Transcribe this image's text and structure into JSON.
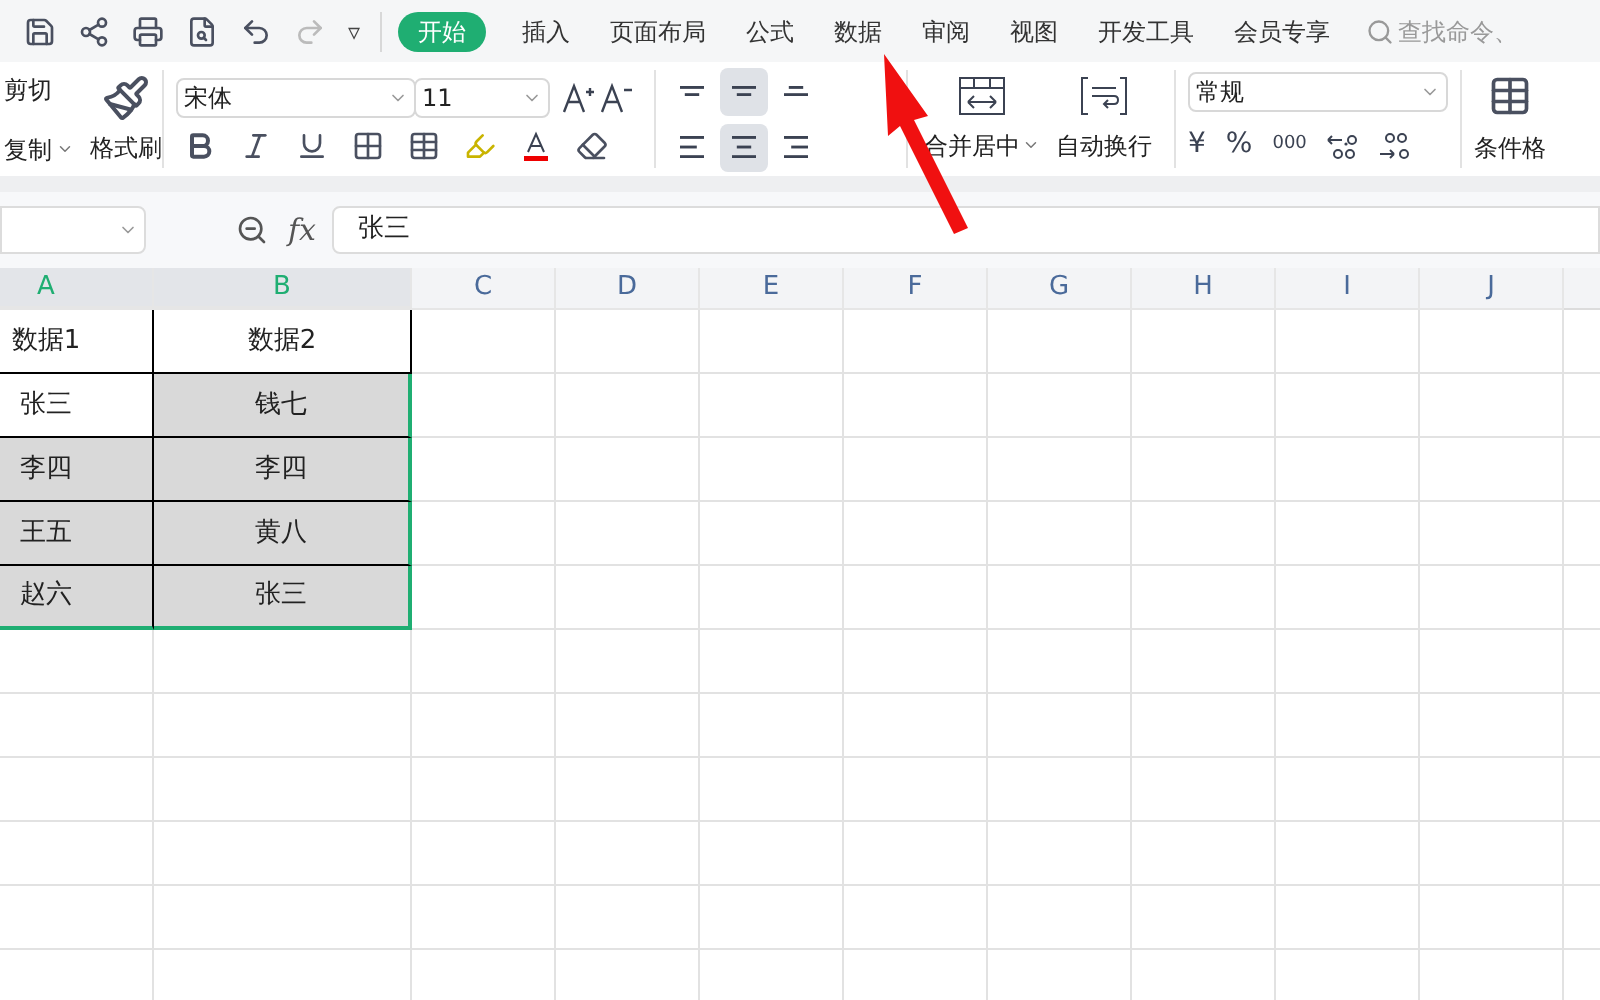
{
  "quick_access": {
    "more": "▿"
  },
  "tabs": [
    {
      "label": "开始",
      "selected": true
    },
    {
      "label": "插入",
      "selected": false
    },
    {
      "label": "页面布局",
      "selected": false
    },
    {
      "label": "公式",
      "selected": false
    },
    {
      "label": "数据",
      "selected": false
    },
    {
      "label": "审阅",
      "selected": false
    },
    {
      "label": "视图",
      "selected": false
    },
    {
      "label": "开发工具",
      "selected": false
    },
    {
      "label": "会员专享",
      "selected": false
    }
  ],
  "search": {
    "placeholder": "查找命令、"
  },
  "ribbon": {
    "cut": "剪切",
    "copy": "复制",
    "format_painter": "格式刷",
    "font": "宋体",
    "font_size": "11",
    "merge": "合并居中",
    "wrap": "自动换行",
    "number_format": "常规",
    "currency": "¥",
    "percent": "%",
    "thousands": "000",
    "conditional": "条件格",
    "align_buttons": [
      {
        "kind": "top",
        "selected": false
      },
      {
        "kind": "middle",
        "selected": true
      },
      {
        "kind": "bottom",
        "selected": false
      },
      {
        "kind": "left",
        "selected": false
      },
      {
        "kind": "center",
        "selected": true
      },
      {
        "kind": "right",
        "selected": false
      }
    ]
  },
  "formula_bar": {
    "fx": "fx",
    "value": "张三"
  },
  "columns": [
    {
      "label": "A",
      "selected": true
    },
    {
      "label": "B",
      "selected": true
    },
    {
      "label": "C",
      "selected": false
    },
    {
      "label": "D",
      "selected": false
    },
    {
      "label": "E",
      "selected": false
    },
    {
      "label": "F",
      "selected": false
    },
    {
      "label": "G",
      "selected": false
    },
    {
      "label": "H",
      "selected": false
    },
    {
      "label": "I",
      "selected": false
    },
    {
      "label": "J",
      "selected": false
    }
  ],
  "rows": [
    [
      {
        "text": "数据1",
        "selected": false
      },
      {
        "text": "数据2",
        "selected": false
      }
    ],
    [
      {
        "text": "张三",
        "selected": false
      },
      {
        "text": "钱七",
        "selected": true
      }
    ],
    [
      {
        "text": "李四",
        "selected": true
      },
      {
        "text": "李四",
        "selected": true
      }
    ],
    [
      {
        "text": "王五",
        "selected": true
      },
      {
        "text": "黄八",
        "selected": true
      }
    ],
    [
      {
        "text": "赵六",
        "selected": true
      },
      {
        "text": "张三",
        "selected": true
      }
    ]
  ]
}
